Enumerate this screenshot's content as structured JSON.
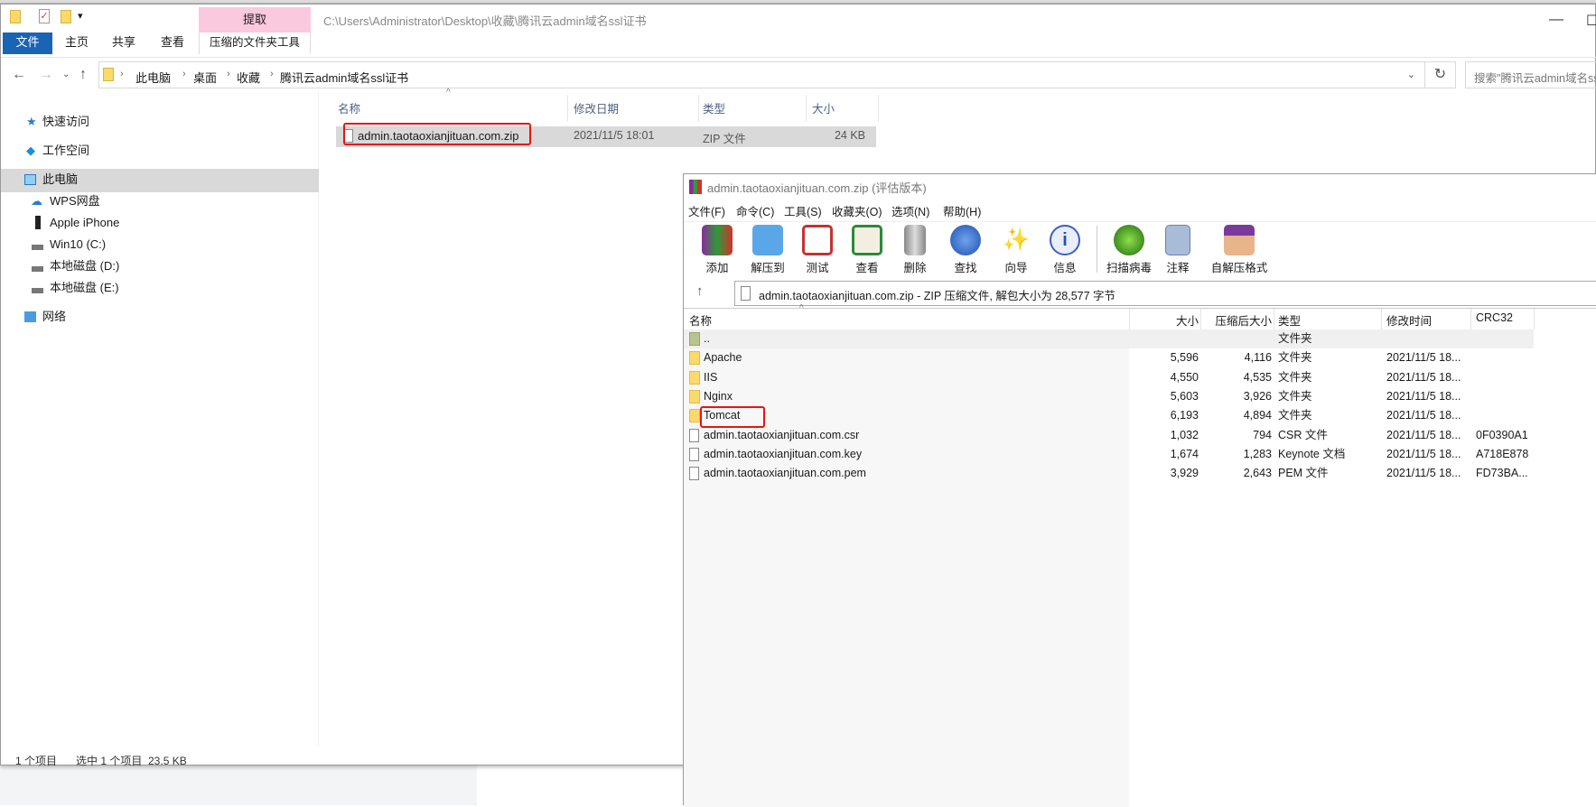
{
  "explorer": {
    "path_title": "C:\\Users\\Administrator\\Desktop\\收藏\\腾讯云admin域名ssl证书",
    "context_tab": "提取",
    "context_tools": "压缩的文件夹工具",
    "ribbon_tabs": [
      "文件",
      "主页",
      "共享",
      "查看"
    ],
    "window_controls": {
      "minimize": "—",
      "maximize": "☐"
    },
    "breadcrumb": [
      "此电脑",
      "桌面",
      "收藏",
      "腾讯云admin域名ssl证书"
    ],
    "search_placeholder": "搜索\"腾讯云admin域名ssl证书\"",
    "sidebar": [
      {
        "label": "快速访问",
        "icon": "star-icon"
      },
      {
        "label": "工作空间",
        "icon": "workspace-icon"
      },
      {
        "label": "此电脑",
        "icon": "computer-icon",
        "selected": true
      },
      {
        "label": "WPS网盘",
        "icon": "cloud-icon"
      },
      {
        "label": "Apple iPhone",
        "icon": "phone-icon"
      },
      {
        "label": "Win10 (C:)",
        "icon": "drive-icon"
      },
      {
        "label": "本地磁盘 (D:)",
        "icon": "drive-icon"
      },
      {
        "label": "本地磁盘 (E:)",
        "icon": "drive-icon"
      },
      {
        "label": "网络",
        "icon": "network-icon"
      }
    ],
    "columns": [
      "名称",
      "修改日期",
      "类型",
      "大小"
    ],
    "files": [
      {
        "name": "admin.taotaoxianjituan.com.zip",
        "date": "2021/11/5 18:01",
        "type": "ZIP 文件",
        "size": "24 KB",
        "selected": true,
        "highlighted": true
      }
    ],
    "status": {
      "count": "1 个项目",
      "selection": "选中 1 个项目  23.5 KB"
    }
  },
  "winrar": {
    "title": "admin.taotaoxianjituan.com.zip (评估版本)",
    "menu": [
      "文件(F)",
      "命令(C)",
      "工具(S)",
      "收藏夹(O)",
      "选项(N)",
      "帮助(H)"
    ],
    "toolbar": [
      "添加",
      "解压到",
      "测试",
      "查看",
      "删除",
      "查找",
      "向导",
      "信息",
      "扫描病毒",
      "注释",
      "自解压格式"
    ],
    "address": "admin.taotaoxianjituan.com.zip - ZIP 压缩文件, 解包大小为 28,577 字节",
    "columns": [
      "名称",
      "大小",
      "压缩后大小",
      "类型",
      "修改时间",
      "CRC32"
    ],
    "rows": [
      {
        "name": "..",
        "size": "",
        "packed": "",
        "type": "文件夹",
        "modified": "",
        "crc": "",
        "kind": "parent"
      },
      {
        "name": "Apache",
        "size": "5,596",
        "packed": "4,116",
        "type": "文件夹",
        "modified": "2021/11/5 18...",
        "crc": "",
        "kind": "folder"
      },
      {
        "name": "IIS",
        "size": "4,550",
        "packed": "4,535",
        "type": "文件夹",
        "modified": "2021/11/5 18...",
        "crc": "",
        "kind": "folder"
      },
      {
        "name": "Nginx",
        "size": "5,603",
        "packed": "3,926",
        "type": "文件夹",
        "modified": "2021/11/5 18...",
        "crc": "",
        "kind": "folder"
      },
      {
        "name": "Tomcat",
        "size": "6,193",
        "packed": "4,894",
        "type": "文件夹",
        "modified": "2021/11/5 18...",
        "crc": "",
        "kind": "folder",
        "highlighted": true
      },
      {
        "name": "admin.taotaoxianjituan.com.csr",
        "size": "1,032",
        "packed": "794",
        "type": "CSR 文件",
        "modified": "2021/11/5 18...",
        "crc": "0F0390A1",
        "kind": "file"
      },
      {
        "name": "admin.taotaoxianjituan.com.key",
        "size": "1,674",
        "packed": "1,283",
        "type": "Keynote 文档",
        "modified": "2021/11/5 18...",
        "crc": "A718E878",
        "kind": "file"
      },
      {
        "name": "admin.taotaoxianjituan.com.pem",
        "size": "3,929",
        "packed": "2,643",
        "type": "PEM 文件",
        "modified": "2021/11/5 18...",
        "crc": "FD73BA...",
        "kind": "file"
      }
    ]
  },
  "colors": {
    "highlight_box": "#e8140f",
    "file_tab": "#1a64b5",
    "context_tab": "#fbc9dd",
    "selection": "#d9d9d9"
  }
}
